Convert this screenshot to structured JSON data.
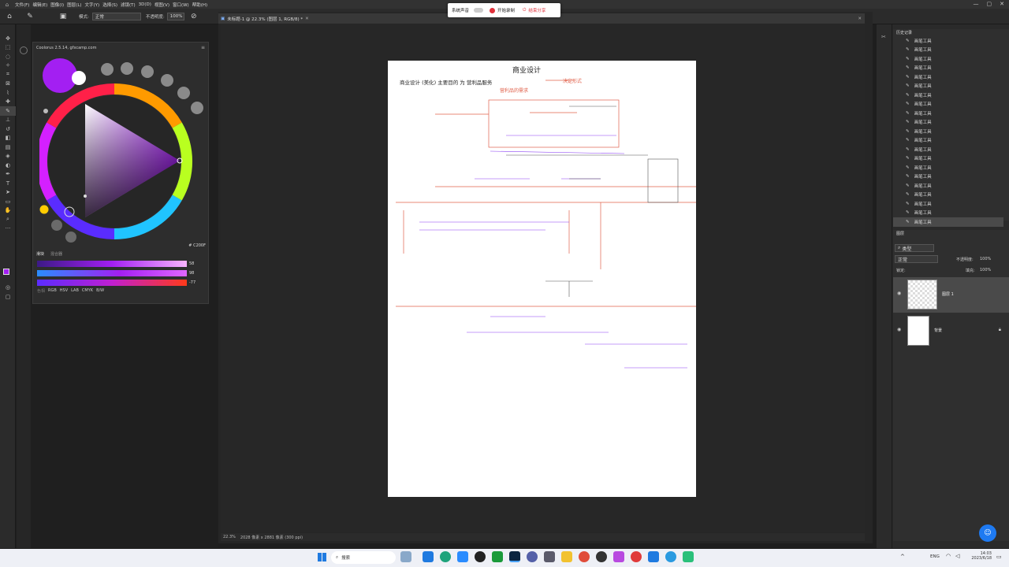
{
  "app": {
    "menu": [
      "文件(F)",
      "编辑(E)",
      "图像(I)",
      "图层(L)",
      "文字(Y)",
      "选择(S)",
      "滤镜(T)",
      "3D(D)",
      "视图(V)",
      "窗口(W)",
      "帮助(H)"
    ]
  },
  "options_bar": {
    "mode_label": "模式:",
    "mode_value": "正常",
    "opacity_label": "不透明度:",
    "opacity_value": "100%"
  },
  "recorder": {
    "sound_label": "系统声音",
    "start_label": "开始录制",
    "share_label": "结束分享"
  },
  "document": {
    "tab_title": "未标题-1 @ 22.3% (图层 1, RGB/8) *",
    "status_zoom": "22.3%",
    "status_info": "2028 像素 x 2881 像素 (300 ppi)"
  },
  "coolorus": {
    "title": "Coolorus 2.5.14, gfxcamp.com",
    "hex": "# C200F",
    "tabs": [
      "滑块",
      "混合器"
    ],
    "slider_values": [
      "58",
      "98",
      "-77"
    ],
    "modes": [
      "色相",
      "RGB",
      "HSV",
      "LAB",
      "CMYK",
      "B/W"
    ],
    "colors": {
      "current": "#a31ff2",
      "previous": "#ffffff"
    }
  },
  "history": {
    "title": "历史记录",
    "items": [
      "画笔工具",
      "画笔工具",
      "画笔工具",
      "画笔工具",
      "画笔工具",
      "画笔工具",
      "画笔工具",
      "画笔工具",
      "画笔工具",
      "画笔工具",
      "画笔工具",
      "画笔工具",
      "画笔工具",
      "画笔工具",
      "画笔工具",
      "画笔工具",
      "画笔工具",
      "画笔工具",
      "画笔工具",
      "画笔工具",
      "画笔工具"
    ]
  },
  "layers": {
    "title": "图层",
    "filter": "类型",
    "blend": "正常",
    "opacity_label": "不透明度:",
    "opacity_value": "100%",
    "lock_label": "锁定:",
    "fill_label": "填充:",
    "fill_value": "100%",
    "items": [
      {
        "name": "图层 1"
      },
      {
        "name": "背景"
      }
    ]
  },
  "sketch": {
    "title": "商业设计",
    "line1": "商业设计 (美化) 主要目的 为 营利品服务",
    "line1_tail": "决定形式",
    "line2": "营利品的需求"
  },
  "taskbar": {
    "search": "搜索",
    "lang": "ENG",
    "time": "14:03",
    "date": "2023/6/18"
  }
}
